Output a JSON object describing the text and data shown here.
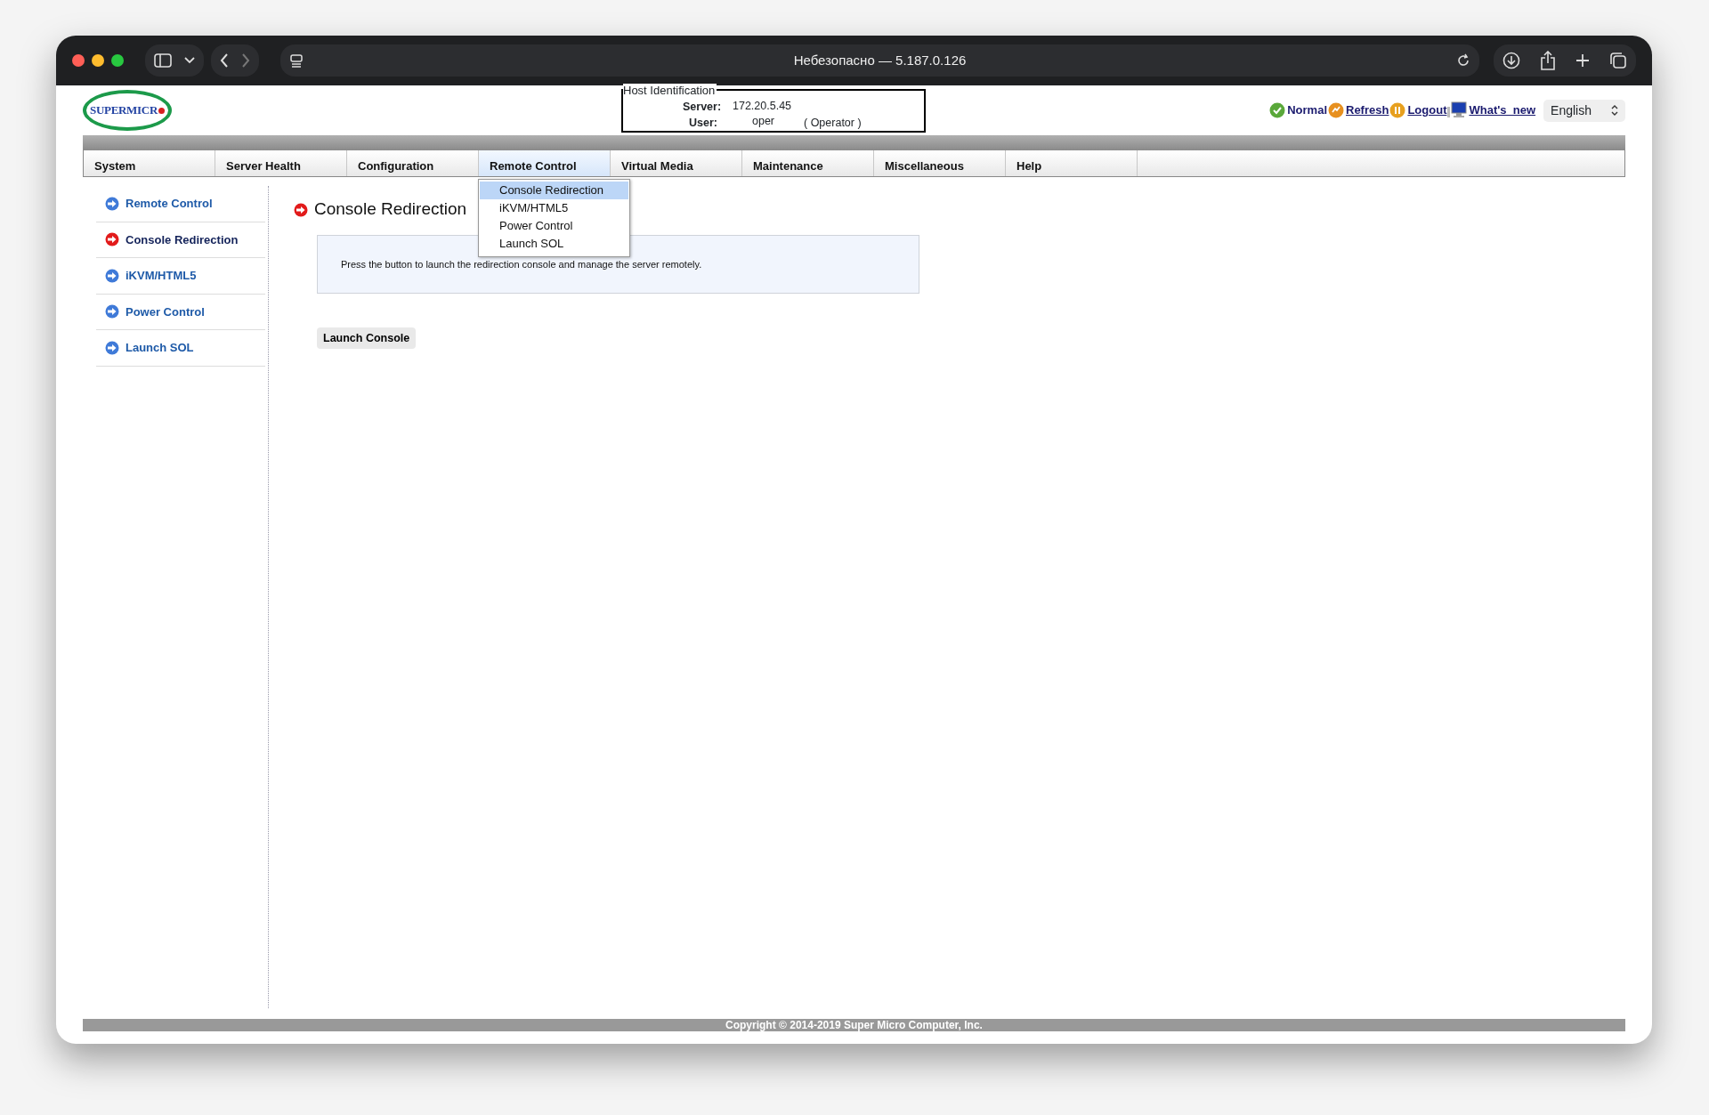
{
  "browser": {
    "address": "Небезопасно — 5.187.0.126"
  },
  "logo": "SUPERMICR",
  "host_identification": {
    "legend": "Host Identification",
    "server_label": "Server:",
    "server": "172.20.5.45",
    "user_label": "User:",
    "user": "oper",
    "role": "( Operator )"
  },
  "header_links": [
    {
      "kind": "status",
      "label": "Normal"
    },
    {
      "kind": "refresh",
      "label": "Refresh"
    },
    {
      "kind": "logout",
      "label": "Logout"
    },
    {
      "kind": "whatsnew",
      "label": "What's_new"
    }
  ],
  "language": {
    "value": "English"
  },
  "tabs": [
    {
      "label": "System",
      "selected": false
    },
    {
      "label": "Server Health",
      "selected": false
    },
    {
      "label": "Configuration",
      "selected": false
    },
    {
      "label": "Remote Control",
      "selected": true
    },
    {
      "label": "Virtual Media",
      "selected": false
    },
    {
      "label": "Maintenance",
      "selected": false
    },
    {
      "label": "Miscellaneous",
      "selected": false
    },
    {
      "label": "Help",
      "selected": false
    }
  ],
  "dropdown": [
    {
      "label": "Console Redirection",
      "selected": true
    },
    {
      "label": "iKVM/HTML5",
      "selected": false
    },
    {
      "label": "Power Control",
      "selected": false
    },
    {
      "label": "Launch SOL",
      "selected": false
    }
  ],
  "sidebar": {
    "items": [
      {
        "label": "Remote Control",
        "selected": false
      },
      {
        "label": "Console Redirection",
        "selected": true
      },
      {
        "label": "iKVM/HTML5",
        "selected": false
      },
      {
        "label": "Power Control",
        "selected": false
      },
      {
        "label": "Launch SOL",
        "selected": false
      }
    ]
  },
  "page_title": "Console Redirection",
  "description": "Press the button to launch the redirection console and manage the server remotely.",
  "launch_button": "Launch Console",
  "footer": "Copyright © 2014-2019 Super Micro Computer, Inc."
}
